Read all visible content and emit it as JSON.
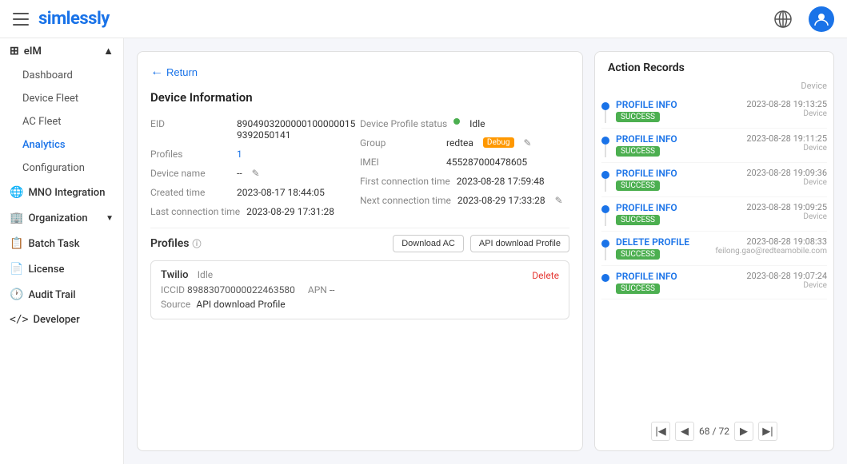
{
  "topbar": {
    "logo": "simlessly",
    "menu_icon": "☰"
  },
  "sidebar": {
    "groups": [
      {
        "label": "eIM",
        "icon": "⊞",
        "expanded": true,
        "items": [
          "Dashboard",
          "Device Fleet",
          "AC Fleet",
          "Analytics",
          "Configuration"
        ]
      }
    ],
    "other_items": [
      {
        "label": "MNO Integration",
        "icon": "🌐"
      },
      {
        "label": "Organization",
        "icon": "🏢"
      },
      {
        "label": "Batch Task",
        "icon": "📋"
      },
      {
        "label": "License",
        "icon": "📄"
      },
      {
        "label": "Audit Trail",
        "icon": "🕐"
      },
      {
        "label": "Developer",
        "icon": "<>"
      }
    ]
  },
  "back_button": "Return",
  "device_info": {
    "title": "Device Information",
    "eid_label": "EID",
    "eid_value": "89049032000001000000159392050141",
    "device_profile_label": "Device Profile status",
    "device_profile_status": "Idle",
    "profiles_label": "Profiles",
    "profiles_value": "1",
    "group_label": "Group",
    "group_value": "redtea",
    "group_badge": "Debug",
    "device_name_label": "Device name",
    "device_name_value": "--",
    "imei_label": "IMEI",
    "imei_value": "455287000478605",
    "created_time_label": "Created time",
    "created_time_value": "2023-08-17 18:44:05",
    "first_connection_label": "First connection time",
    "first_connection_value": "2023-08-28 17:59:48",
    "last_connection_label": "Last connection time",
    "last_connection_value": "2023-08-29 17:31:28",
    "next_connection_label": "Next connection time",
    "next_connection_value": "2023-08-29 17:33:28"
  },
  "profiles_section": {
    "title": "Profiles",
    "download_ac_btn": "Download AC",
    "api_download_btn": "API download Profile",
    "profile": {
      "name": "Twilio",
      "status": "Idle",
      "iccid_label": "ICCID",
      "iccid_value": "89883070000022463580",
      "apn_label": "APN",
      "apn_value": "--",
      "source_label": "Source",
      "source_value": "API download Profile",
      "delete_label": "Delete"
    }
  },
  "action_records": {
    "title": "Action Records",
    "column_device": "Device",
    "items": [
      {
        "name": "PROFILE INFO",
        "badge": "SUCCESS",
        "time": "2023-08-28 19:13:25",
        "source": "Device"
      },
      {
        "name": "PROFILE INFO",
        "badge": "SUCCESS",
        "time": "2023-08-28 19:11:25",
        "source": "Device"
      },
      {
        "name": "PROFILE INFO",
        "badge": "SUCCESS",
        "time": "2023-08-28 19:09:36",
        "source": "Device"
      },
      {
        "name": "PROFILE INFO",
        "badge": "SUCCESS",
        "time": "2023-08-28 19:09:25",
        "source": "Device"
      },
      {
        "name": "DELETE PROFILE",
        "badge": "SUCCESS",
        "time": "2023-08-28 19:08:33",
        "source": "feilong.gao@redteamobile.com"
      },
      {
        "name": "PROFILE INFO",
        "badge": "SUCCESS",
        "time": "2023-08-28 19:07:24",
        "source": "Device"
      }
    ],
    "pagination": {
      "current": "68",
      "total": "72"
    }
  }
}
